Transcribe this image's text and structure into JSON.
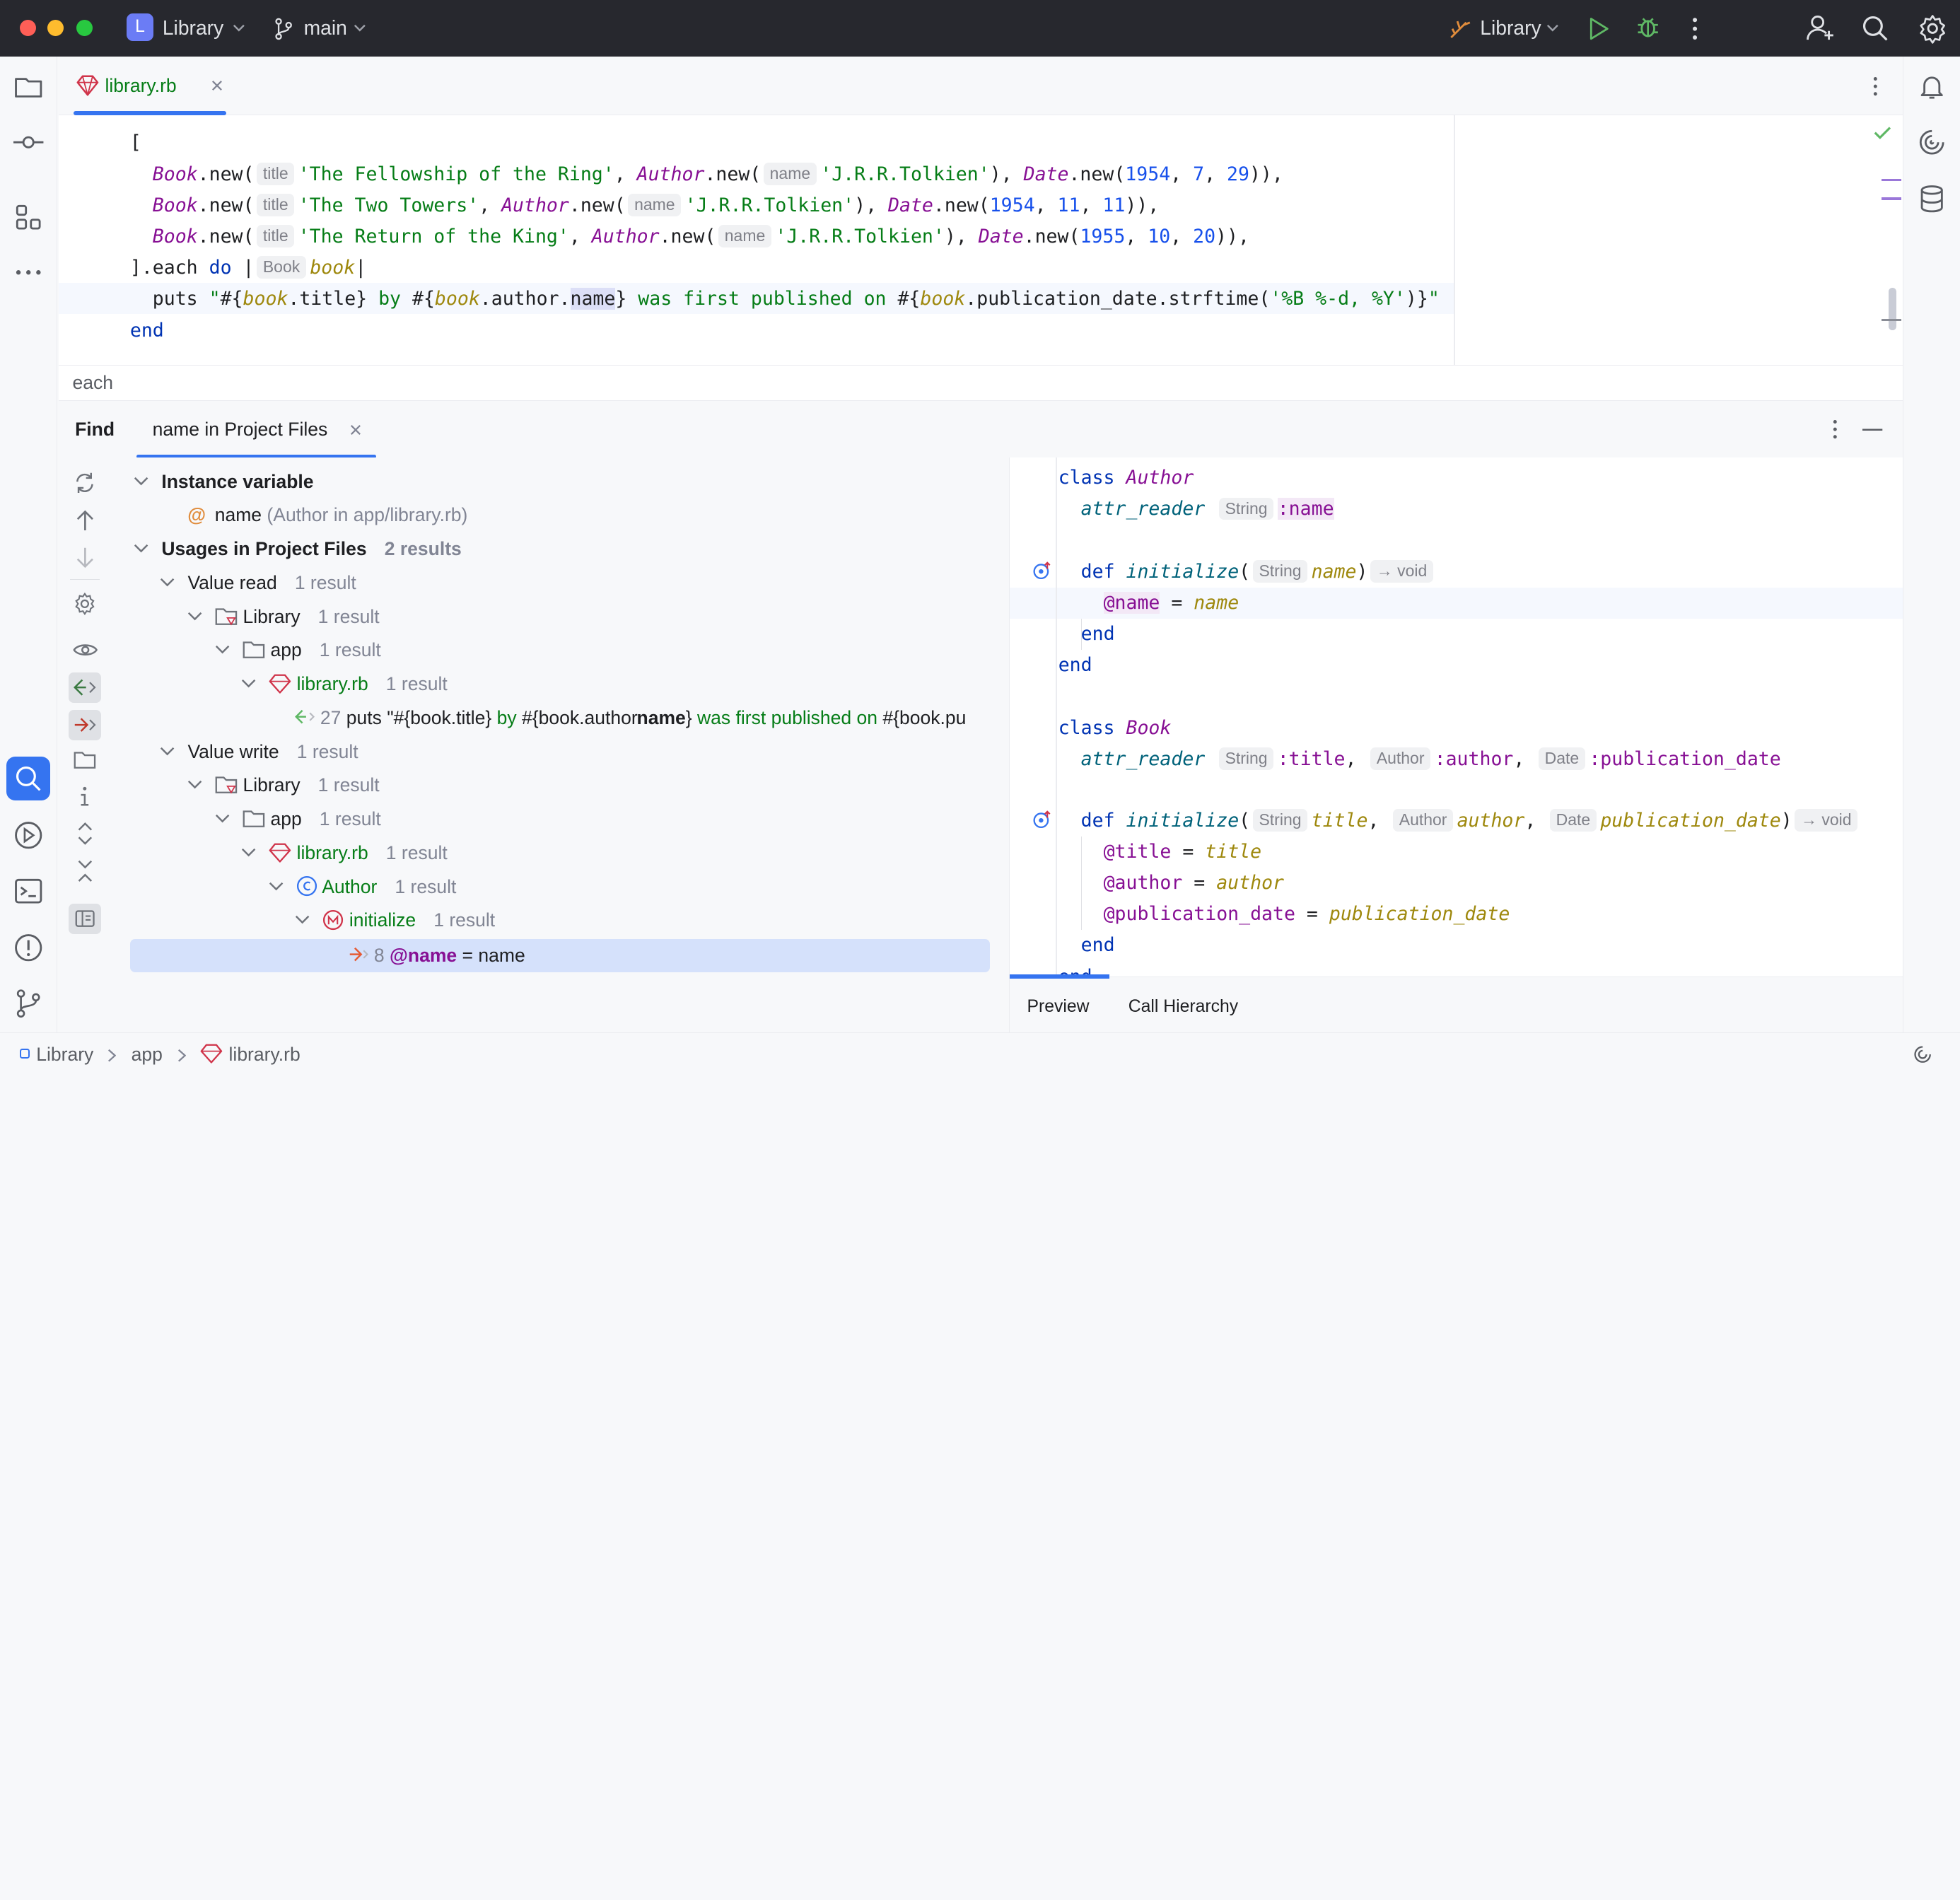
{
  "titlebar": {
    "project_badge": "L",
    "project_name": "Library",
    "branch": "main",
    "run_config": "Library"
  },
  "editor": {
    "tab_label": "library.rb",
    "breadcrumb": "each",
    "hint_title": "title",
    "hint_name": "name",
    "hint_book": "Book"
  },
  "find": {
    "title": "Find",
    "tab_label": "name in Project Files",
    "tree": {
      "instance_variable": "Instance variable",
      "ivar_name": "name",
      "ivar_detail": "(Author in app/library.rb)",
      "usages": "Usages in Project Files",
      "usages_count": "2 results",
      "value_read": "Value read",
      "value_write": "Value write",
      "one_result": "1 result",
      "library": "Library",
      "app": "app",
      "file": "library.rb",
      "author_class": "Author",
      "initialize": "initialize",
      "read_line_no": "27",
      "read_line_pre": "puts \"#{book.title}",
      "read_line_by": "by",
      "read_line_mid": "#{book.author.",
      "read_line_match": "name",
      "read_line_post": "}",
      "read_line_tail": "was first published on",
      "read_line_end": "#{book.pu",
      "write_line_no": "8",
      "write_line_match": "@name",
      "write_line_rest": "= name"
    },
    "preview_tabs": [
      "Preview",
      "Call Hierarchy"
    ]
  },
  "preview_hints": {
    "string": "String",
    "author": "Author",
    "date": "Date",
    "void": "→ void"
  },
  "statusbar": {
    "crumbs": [
      "Library",
      "app",
      "library.rb"
    ]
  },
  "colors": {
    "titlebar_bg": "#27282e",
    "accent": "#3574f0",
    "keyword": "#0033b3",
    "string": "#067d17",
    "number": "#1750eb",
    "class_name": "#871094",
    "selection": "#d5e1fb"
  },
  "icons": [
    "folder-icon",
    "commit-icon",
    "structure-icon",
    "more-icon",
    "find-icon",
    "run-icon",
    "terminal-icon",
    "problems-icon",
    "git-icon",
    "notifications-icon",
    "ai-icon",
    "database-icon"
  ]
}
